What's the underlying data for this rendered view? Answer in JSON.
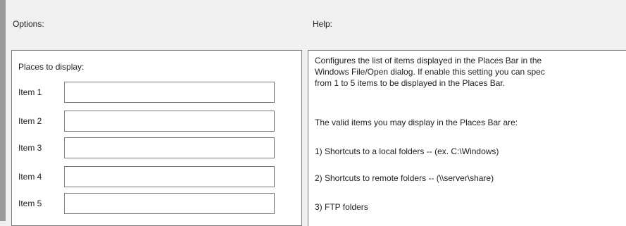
{
  "options": {
    "label": "Options:",
    "places_title": "Places to display:",
    "items": [
      {
        "label": "Item 1",
        "value": ""
      },
      {
        "label": "Item 2",
        "value": ""
      },
      {
        "label": "Item 3",
        "value": ""
      },
      {
        "label": "Item 4",
        "value": ""
      },
      {
        "label": "Item 5",
        "value": ""
      }
    ]
  },
  "help": {
    "label": "Help:",
    "paragraphs": [
      {
        "lines": [
          "Configures the list of items displayed in the Places Bar in the",
          "Windows File/Open dialog. If enable this setting you can spec",
          "from 1 to 5 items to be displayed in the Places Bar."
        ]
      },
      {
        "lines": [
          "The valid items you may display in the Places Bar are:"
        ]
      },
      {
        "lines": [
          "1) Shortcuts to a local folders -- (ex. C:\\Windows)"
        ]
      },
      {
        "lines": [
          "2) Shortcuts to remote folders -- (\\\\server\\share)"
        ]
      },
      {
        "lines": [
          "3) FTP folders"
        ]
      }
    ]
  }
}
